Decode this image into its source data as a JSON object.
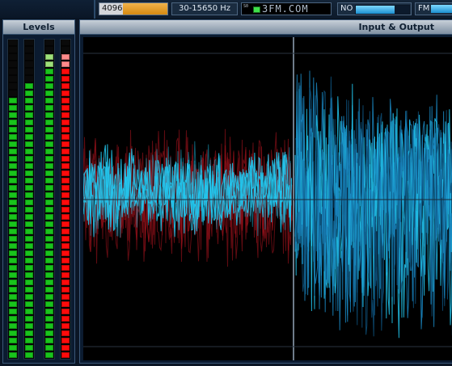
{
  "topbar": {
    "buffer_label": "4096",
    "buffer_fill_fraction": 0.66,
    "frequency_label": "30-15650 Hz",
    "stereo_icon_label": "S0",
    "station_label": "3FM.COM",
    "noise_label": "NO",
    "noise_level_fraction": 0.72,
    "fm_label": "FM",
    "fm_level_fraction": 0.85
  },
  "levels_panel": {
    "title": "Levels",
    "meters": [
      {
        "color": "green",
        "level_fraction": 0.82
      },
      {
        "color": "green",
        "level_fraction": 0.86
      },
      {
        "color": "green",
        "peak": "lightgreen",
        "level_fraction": 0.96
      },
      {
        "color": "red",
        "peak": "pink",
        "level_fraction": 0.96
      }
    ]
  },
  "io_panel": {
    "title": "Input & Output",
    "input_trace": "cyan with red",
    "output_trace": "cyan"
  },
  "colors": {
    "accent": "#d68a12",
    "meter_green": "#19c41c",
    "meter_red": "#ff0b0b",
    "trace_cyan": "#22c8f0",
    "trace_red": "#a0121c"
  }
}
